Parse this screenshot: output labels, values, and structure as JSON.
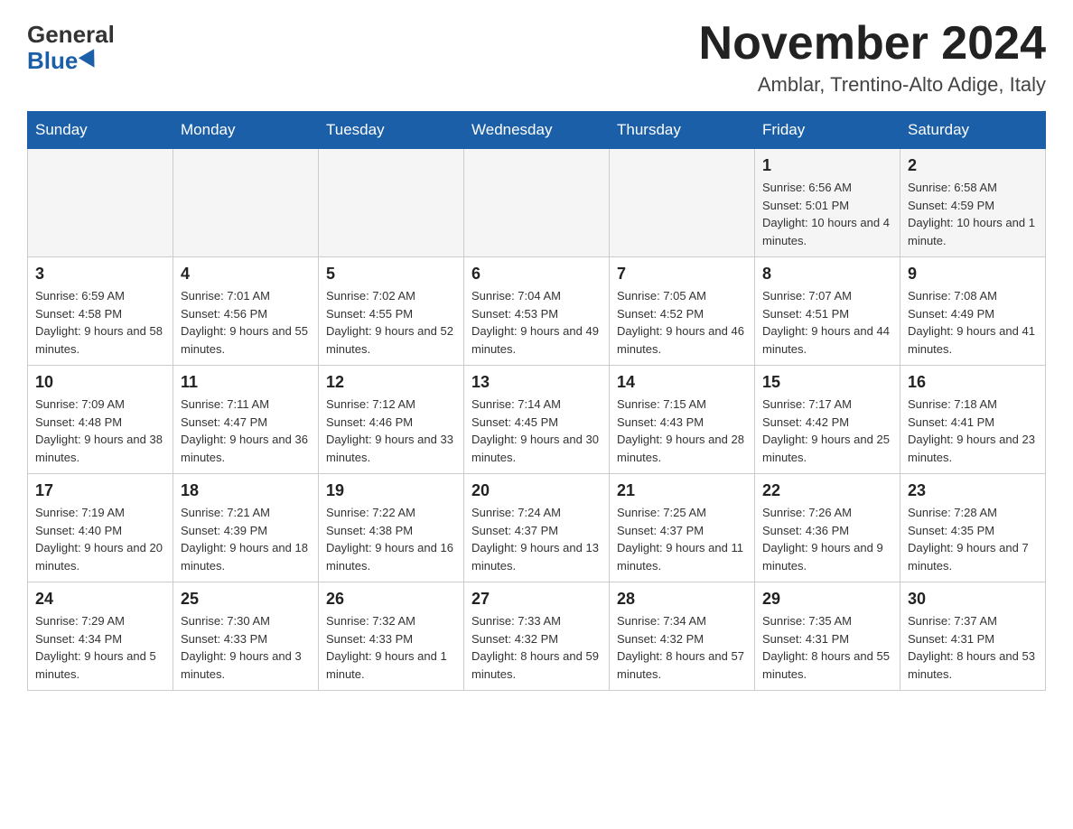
{
  "header": {
    "logo_general": "General",
    "logo_blue": "Blue",
    "month_title": "November 2024",
    "subtitle": "Amblar, Trentino-Alto Adige, Italy"
  },
  "days_of_week": [
    "Sunday",
    "Monday",
    "Tuesday",
    "Wednesday",
    "Thursday",
    "Friday",
    "Saturday"
  ],
  "weeks": [
    [
      {
        "day": "",
        "info": ""
      },
      {
        "day": "",
        "info": ""
      },
      {
        "day": "",
        "info": ""
      },
      {
        "day": "",
        "info": ""
      },
      {
        "day": "",
        "info": ""
      },
      {
        "day": "1",
        "info": "Sunrise: 6:56 AM\nSunset: 5:01 PM\nDaylight: 10 hours and 4 minutes."
      },
      {
        "day": "2",
        "info": "Sunrise: 6:58 AM\nSunset: 4:59 PM\nDaylight: 10 hours and 1 minute."
      }
    ],
    [
      {
        "day": "3",
        "info": "Sunrise: 6:59 AM\nSunset: 4:58 PM\nDaylight: 9 hours and 58 minutes."
      },
      {
        "day": "4",
        "info": "Sunrise: 7:01 AM\nSunset: 4:56 PM\nDaylight: 9 hours and 55 minutes."
      },
      {
        "day": "5",
        "info": "Sunrise: 7:02 AM\nSunset: 4:55 PM\nDaylight: 9 hours and 52 minutes."
      },
      {
        "day": "6",
        "info": "Sunrise: 7:04 AM\nSunset: 4:53 PM\nDaylight: 9 hours and 49 minutes."
      },
      {
        "day": "7",
        "info": "Sunrise: 7:05 AM\nSunset: 4:52 PM\nDaylight: 9 hours and 46 minutes."
      },
      {
        "day": "8",
        "info": "Sunrise: 7:07 AM\nSunset: 4:51 PM\nDaylight: 9 hours and 44 minutes."
      },
      {
        "day": "9",
        "info": "Sunrise: 7:08 AM\nSunset: 4:49 PM\nDaylight: 9 hours and 41 minutes."
      }
    ],
    [
      {
        "day": "10",
        "info": "Sunrise: 7:09 AM\nSunset: 4:48 PM\nDaylight: 9 hours and 38 minutes."
      },
      {
        "day": "11",
        "info": "Sunrise: 7:11 AM\nSunset: 4:47 PM\nDaylight: 9 hours and 36 minutes."
      },
      {
        "day": "12",
        "info": "Sunrise: 7:12 AM\nSunset: 4:46 PM\nDaylight: 9 hours and 33 minutes."
      },
      {
        "day": "13",
        "info": "Sunrise: 7:14 AM\nSunset: 4:45 PM\nDaylight: 9 hours and 30 minutes."
      },
      {
        "day": "14",
        "info": "Sunrise: 7:15 AM\nSunset: 4:43 PM\nDaylight: 9 hours and 28 minutes."
      },
      {
        "day": "15",
        "info": "Sunrise: 7:17 AM\nSunset: 4:42 PM\nDaylight: 9 hours and 25 minutes."
      },
      {
        "day": "16",
        "info": "Sunrise: 7:18 AM\nSunset: 4:41 PM\nDaylight: 9 hours and 23 minutes."
      }
    ],
    [
      {
        "day": "17",
        "info": "Sunrise: 7:19 AM\nSunset: 4:40 PM\nDaylight: 9 hours and 20 minutes."
      },
      {
        "day": "18",
        "info": "Sunrise: 7:21 AM\nSunset: 4:39 PM\nDaylight: 9 hours and 18 minutes."
      },
      {
        "day": "19",
        "info": "Sunrise: 7:22 AM\nSunset: 4:38 PM\nDaylight: 9 hours and 16 minutes."
      },
      {
        "day": "20",
        "info": "Sunrise: 7:24 AM\nSunset: 4:37 PM\nDaylight: 9 hours and 13 minutes."
      },
      {
        "day": "21",
        "info": "Sunrise: 7:25 AM\nSunset: 4:37 PM\nDaylight: 9 hours and 11 minutes."
      },
      {
        "day": "22",
        "info": "Sunrise: 7:26 AM\nSunset: 4:36 PM\nDaylight: 9 hours and 9 minutes."
      },
      {
        "day": "23",
        "info": "Sunrise: 7:28 AM\nSunset: 4:35 PM\nDaylight: 9 hours and 7 minutes."
      }
    ],
    [
      {
        "day": "24",
        "info": "Sunrise: 7:29 AM\nSunset: 4:34 PM\nDaylight: 9 hours and 5 minutes."
      },
      {
        "day": "25",
        "info": "Sunrise: 7:30 AM\nSunset: 4:33 PM\nDaylight: 9 hours and 3 minutes."
      },
      {
        "day": "26",
        "info": "Sunrise: 7:32 AM\nSunset: 4:33 PM\nDaylight: 9 hours and 1 minute."
      },
      {
        "day": "27",
        "info": "Sunrise: 7:33 AM\nSunset: 4:32 PM\nDaylight: 8 hours and 59 minutes."
      },
      {
        "day": "28",
        "info": "Sunrise: 7:34 AM\nSunset: 4:32 PM\nDaylight: 8 hours and 57 minutes."
      },
      {
        "day": "29",
        "info": "Sunrise: 7:35 AM\nSunset: 4:31 PM\nDaylight: 8 hours and 55 minutes."
      },
      {
        "day": "30",
        "info": "Sunrise: 7:37 AM\nSunset: 4:31 PM\nDaylight: 8 hours and 53 minutes."
      }
    ]
  ]
}
